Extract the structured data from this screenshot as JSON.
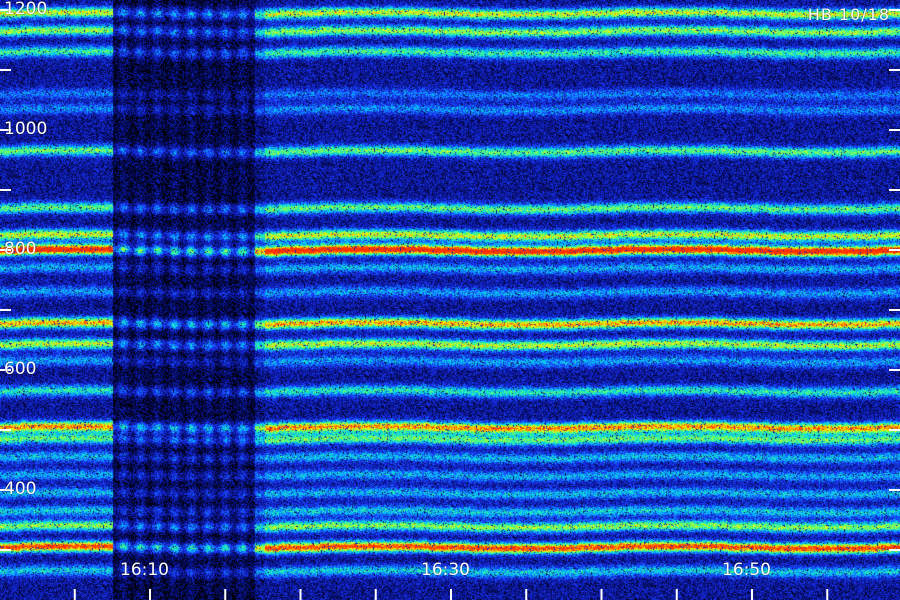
{
  "chart_data": {
    "type": "heatmap",
    "title": "HB 10/18",
    "xlabel": "",
    "ylabel": "",
    "y_ticks": [
      {
        "value": 1200,
        "label": "1200"
      },
      {
        "value": 1000,
        "label": "1000"
      },
      {
        "value": 800,
        "label": "800"
      },
      {
        "value": 600,
        "label": "600"
      },
      {
        "value": 400,
        "label": "400"
      }
    ],
    "y_minor_ticks": [
      1300,
      1100,
      900,
      700,
      500,
      300
    ],
    "ylim": [
      222,
      1200
    ],
    "x_ticks": [
      {
        "value": "16:10",
        "label": "16:10"
      },
      {
        "value": "16:30",
        "label": "16:30"
      },
      {
        "value": "16:50",
        "label": "16:50"
      }
    ],
    "x_minor_ticks": [
      "16:00",
      "16:05",
      "16:15",
      "16:20",
      "16:25",
      "16:35",
      "16:40",
      "16:45",
      "16:55",
      "17:00",
      "17:05"
    ],
    "xlim": [
      "16:05",
      "17:05"
    ],
    "colormap": [
      "#000000",
      "#0a14a0",
      "#1e3cff",
      "#00c8ff",
      "#40ff80",
      "#ffff00",
      "#ff3000"
    ],
    "bands": [
      {
        "y": 1195,
        "intensity": 0.62
      },
      {
        "y": 1165,
        "intensity": 0.55
      },
      {
        "y": 1130,
        "intensity": 0.45
      },
      {
        "y": 1060,
        "intensity": 0.22
      },
      {
        "y": 1035,
        "intensity": 0.25
      },
      {
        "y": 965,
        "intensity": 0.5
      },
      {
        "y": 870,
        "intensity": 0.5
      },
      {
        "y": 825,
        "intensity": 0.62
      },
      {
        "y": 800,
        "intensity": 0.95
      },
      {
        "y": 770,
        "intensity": 0.3
      },
      {
        "y": 730,
        "intensity": 0.28
      },
      {
        "y": 678,
        "intensity": 0.72
      },
      {
        "y": 643,
        "intensity": 0.6
      },
      {
        "y": 615,
        "intensity": 0.28
      },
      {
        "y": 565,
        "intensity": 0.42
      },
      {
        "y": 505,
        "intensity": 0.75
      },
      {
        "y": 485,
        "intensity": 0.5
      },
      {
        "y": 455,
        "intensity": 0.32
      },
      {
        "y": 425,
        "intensity": 0.3
      },
      {
        "y": 395,
        "intensity": 0.32
      },
      {
        "y": 365,
        "intensity": 0.35
      },
      {
        "y": 340,
        "intensity": 0.55
      },
      {
        "y": 305,
        "intensity": 0.85
      },
      {
        "y": 265,
        "intensity": 0.35
      }
    ]
  }
}
